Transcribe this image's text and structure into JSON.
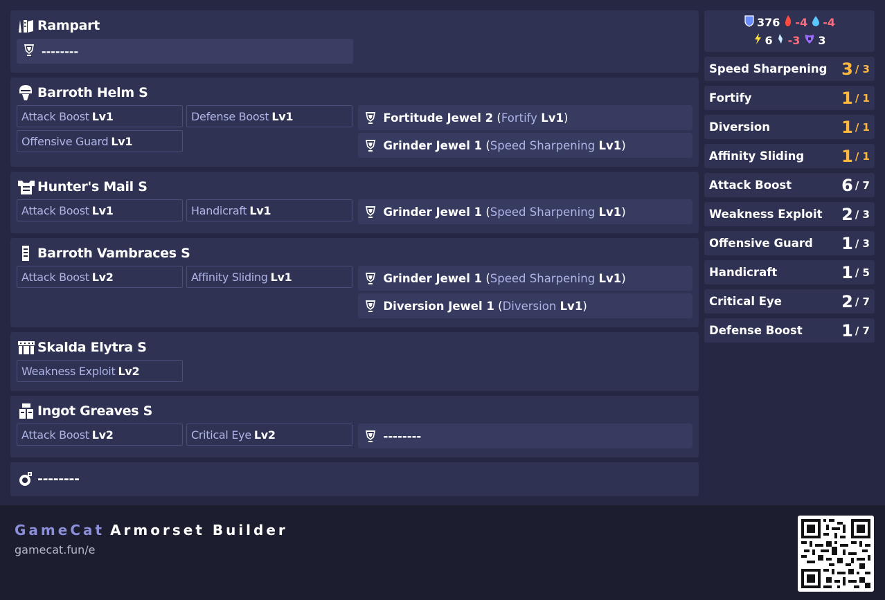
{
  "equipment": [
    {
      "slot": "weapon",
      "name": "Rampart",
      "icon": "weapon-icon",
      "skills": [],
      "decorations": [],
      "weapon_slot": "--------"
    },
    {
      "slot": "head",
      "name": "Barroth Helm S",
      "icon": "helm-icon",
      "skills": [
        {
          "name": "Attack Boost",
          "level": "Lv1"
        },
        {
          "name": "Defense Boost",
          "level": "Lv1"
        },
        {
          "name": "Offensive Guard",
          "level": "Lv1"
        }
      ],
      "decorations": [
        {
          "jewel": "Fortitude Jewel 2",
          "skill": "Fortify",
          "level": "Lv1"
        },
        {
          "jewel": "Grinder Jewel 1",
          "skill": "Speed Sharpening",
          "level": "Lv1"
        }
      ]
    },
    {
      "slot": "chest",
      "name": "Hunter's Mail S",
      "icon": "chest-icon",
      "skills": [
        {
          "name": "Attack Boost",
          "level": "Lv1"
        },
        {
          "name": "Handicraft",
          "level": "Lv1"
        }
      ],
      "decorations": [
        {
          "jewel": "Grinder Jewel 1",
          "skill": "Speed Sharpening",
          "level": "Lv1"
        }
      ]
    },
    {
      "slot": "arms",
      "name": "Barroth Vambraces S",
      "icon": "arms-icon",
      "skills": [
        {
          "name": "Attack Boost",
          "level": "Lv2"
        },
        {
          "name": "Affinity Sliding",
          "level": "Lv1"
        }
      ],
      "decorations": [
        {
          "jewel": "Grinder Jewel 1",
          "skill": "Speed Sharpening",
          "level": "Lv1"
        },
        {
          "jewel": "Diversion Jewel 1",
          "skill": "Diversion",
          "level": "Lv1"
        }
      ]
    },
    {
      "slot": "waist",
      "name": "Skalda Elytra S",
      "icon": "waist-icon",
      "skills": [
        {
          "name": "Weakness Exploit",
          "level": "Lv2"
        }
      ],
      "decorations": []
    },
    {
      "slot": "legs",
      "name": "Ingot Greaves S",
      "icon": "legs-icon",
      "skills": [
        {
          "name": "Attack Boost",
          "level": "Lv2"
        },
        {
          "name": "Critical Eye",
          "level": "Lv2"
        }
      ],
      "decorations": [],
      "empty_deco": "--------"
    },
    {
      "slot": "charm",
      "name": "--------",
      "icon": "charm-icon",
      "skills": [],
      "decorations": []
    }
  ],
  "stats": {
    "defense": "376",
    "fire": "-4",
    "water": "-4",
    "thunder": "6",
    "ice": "-3",
    "dragon": "3"
  },
  "skill_totals": [
    {
      "name": "Speed Sharpening",
      "current": "3",
      "max": "/ 3",
      "maxed": true
    },
    {
      "name": "Fortify",
      "current": "1",
      "max": "/ 1",
      "maxed": true
    },
    {
      "name": "Diversion",
      "current": "1",
      "max": "/ 1",
      "maxed": true
    },
    {
      "name": "Affinity Sliding",
      "current": "1",
      "max": "/ 1",
      "maxed": true
    },
    {
      "name": "Attack Boost",
      "current": "6",
      "max": "/ 7",
      "maxed": false
    },
    {
      "name": "Weakness Exploit",
      "current": "2",
      "max": "/ 3",
      "maxed": false
    },
    {
      "name": "Offensive Guard",
      "current": "1",
      "max": "/ 3",
      "maxed": false
    },
    {
      "name": "Handicraft",
      "current": "1",
      "max": "/ 5",
      "maxed": false
    },
    {
      "name": "Critical Eye",
      "current": "2",
      "max": "/ 7",
      "maxed": false
    },
    {
      "name": "Defense Boost",
      "current": "1",
      "max": "/ 7",
      "maxed": false
    }
  ],
  "footer": {
    "brand1": "GameCat",
    "brand2": "Armorset Builder",
    "url": "gamecat.fun/e"
  },
  "colors": {
    "accent": "#ffb83d",
    "skill_name": "#aeb4e6",
    "negative": "#ff6b7a",
    "background": "#262843",
    "card": "#2f3252"
  }
}
